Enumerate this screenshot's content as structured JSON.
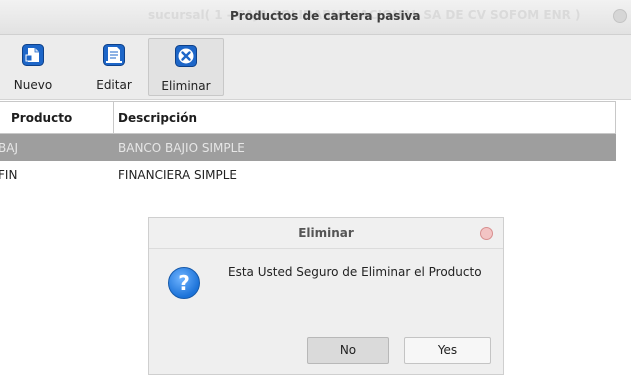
{
  "window": {
    "background_title": "sucursal( 1 - CAJA SOLIDARIA NACIONAL SA DE CV SOFOM ENR )",
    "title": "Productos de cartera pasiva"
  },
  "toolbar": {
    "buttons": [
      {
        "label": "Nuevo",
        "icon": "new-document-icon"
      },
      {
        "label": "Editar",
        "icon": "edit-document-icon"
      },
      {
        "label": "Eliminar",
        "icon": "delete-x-icon"
      }
    ]
  },
  "table": {
    "headers": [
      "Producto",
      "Descripción"
    ],
    "rows": [
      {
        "producto": "BAJ",
        "descripcion": "BANCO BAJIO SIMPLE",
        "selected": true
      },
      {
        "producto": "FIN",
        "descripcion": "FINANCIERA SIMPLE",
        "selected": false
      }
    ]
  },
  "dialog": {
    "title": "Eliminar",
    "icon": "question-icon",
    "message": "Esta Usted Seguro de Eliminar el Producto",
    "no_label": "No",
    "yes_label": "Yes"
  },
  "colors": {
    "selected_row": "#9e9e9e",
    "icon_blue": "#1d66c8"
  }
}
